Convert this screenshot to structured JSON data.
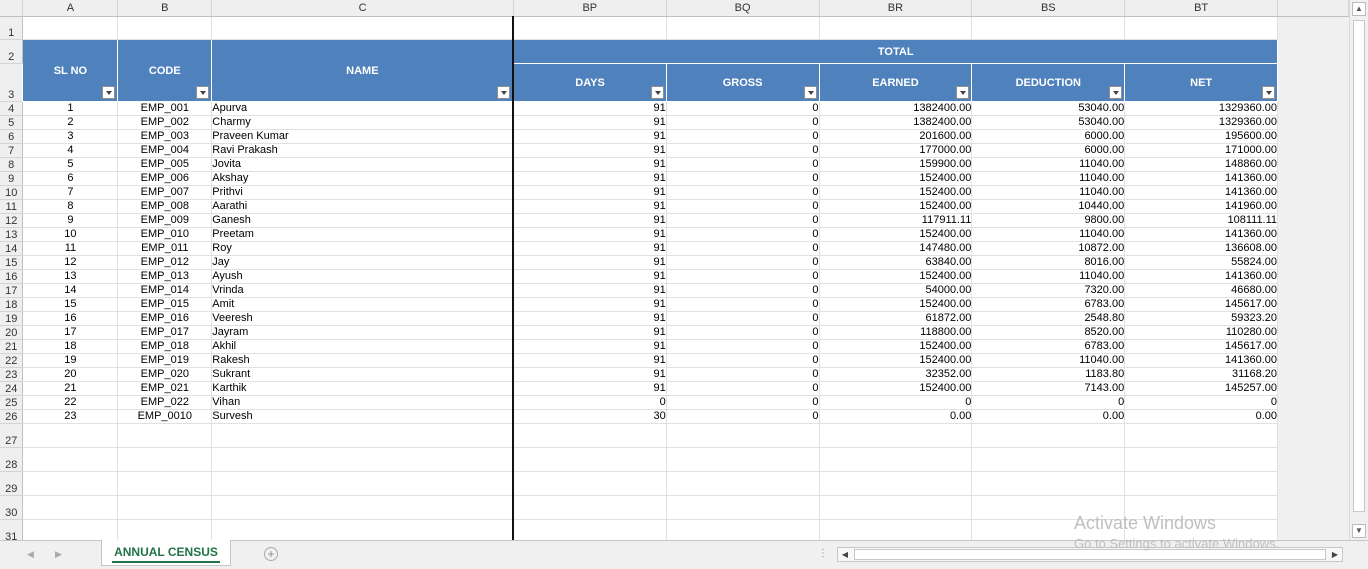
{
  "columns": [
    "A",
    "B",
    "C",
    "BP",
    "BQ",
    "BR",
    "BS",
    "BT"
  ],
  "header": {
    "total_label": "TOTAL",
    "sl_no": "SL NO",
    "code": "CODE",
    "name": "NAME",
    "days": "DAYS",
    "gross": "GROSS",
    "earned": "EARNED",
    "deduction": "DEDUCTION",
    "net": "NET"
  },
  "row_numbers": [
    "1",
    "2",
    "3",
    "4",
    "5",
    "6",
    "7",
    "8",
    "9",
    "10",
    "11",
    "12",
    "13",
    "14",
    "15",
    "16",
    "17",
    "18",
    "19",
    "20",
    "21",
    "22",
    "23",
    "24",
    "25",
    "26",
    "27",
    "28",
    "29",
    "30",
    "31"
  ],
  "rows": [
    [
      "1",
      "EMP_001",
      "Apurva",
      "91",
      "0",
      "1382400.00",
      "53040.00",
      "1329360.00"
    ],
    [
      "2",
      "EMP_002",
      "Charmy",
      "91",
      "0",
      "1382400.00",
      "53040.00",
      "1329360.00"
    ],
    [
      "3",
      "EMP_003",
      "Praveen Kumar",
      "91",
      "0",
      "201600.00",
      "6000.00",
      "195600.00"
    ],
    [
      "4",
      "EMP_004",
      "Ravi Prakash",
      "91",
      "0",
      "177000.00",
      "6000.00",
      "171000.00"
    ],
    [
      "5",
      "EMP_005",
      "Jovita",
      "91",
      "0",
      "159900.00",
      "11040.00",
      "148860.00"
    ],
    [
      "6",
      "EMP_006",
      "Akshay",
      "91",
      "0",
      "152400.00",
      "11040.00",
      "141360.00"
    ],
    [
      "7",
      "EMP_007",
      "Prithvi",
      "91",
      "0",
      "152400.00",
      "11040.00",
      "141360.00"
    ],
    [
      "8",
      "EMP_008",
      "Aarathi",
      "91",
      "0",
      "152400.00",
      "10440.00",
      "141960.00"
    ],
    [
      "9",
      "EMP_009",
      "Ganesh",
      "91",
      "0",
      "117911.11",
      "9800.00",
      "108111.11"
    ],
    [
      "10",
      "EMP_010",
      "Preetam",
      "91",
      "0",
      "152400.00",
      "11040.00",
      "141360.00"
    ],
    [
      "11",
      "EMP_011",
      "Roy",
      "91",
      "0",
      "147480.00",
      "10872.00",
      "136608.00"
    ],
    [
      "12",
      "EMP_012",
      "Jay",
      "91",
      "0",
      "63840.00",
      "8016.00",
      "55824.00"
    ],
    [
      "13",
      "EMP_013",
      "Ayush",
      "91",
      "0",
      "152400.00",
      "11040.00",
      "141360.00"
    ],
    [
      "14",
      "EMP_014",
      "Vrinda",
      "91",
      "0",
      "54000.00",
      "7320.00",
      "46680.00"
    ],
    [
      "15",
      "EMP_015",
      "Amit",
      "91",
      "0",
      "152400.00",
      "6783.00",
      "145617.00"
    ],
    [
      "16",
      "EMP_016",
      "Veeresh",
      "91",
      "0",
      "61872.00",
      "2548.80",
      "59323.20"
    ],
    [
      "17",
      "EMP_017",
      "Jayram",
      "91",
      "0",
      "118800.00",
      "8520.00",
      "110280.00"
    ],
    [
      "18",
      "EMP_018",
      "Akhil",
      "91",
      "0",
      "152400.00",
      "6783.00",
      "145617.00"
    ],
    [
      "19",
      "EMP_019",
      "Rakesh",
      "91",
      "0",
      "152400.00",
      "11040.00",
      "141360.00"
    ],
    [
      "20",
      "EMP_020",
      "Sukrant",
      "91",
      "0",
      "32352.00",
      "1183.80",
      "31168.20"
    ],
    [
      "21",
      "EMP_021",
      "Karthik",
      "91",
      "0",
      "152400.00",
      "7143.00",
      "145257.00"
    ],
    [
      "22",
      "EMP_022",
      "Vihan",
      "0",
      "0",
      "0",
      "0",
      "0"
    ],
    [
      "23",
      "EMP_0010",
      "Survesh",
      "30",
      "0",
      "0.00",
      "0.00",
      "0.00"
    ]
  ],
  "sheet_tab": "ANNUAL CENSUS",
  "watermark": {
    "line1": "Activate Windows",
    "line2": "Go to Settings to activate Windows."
  },
  "icons": {
    "add_sheet": "plus-circle-icon",
    "filter": "filter-dropdown-icon"
  },
  "colors": {
    "header_fill": "#4f81bd",
    "tab_text": "#217346"
  }
}
